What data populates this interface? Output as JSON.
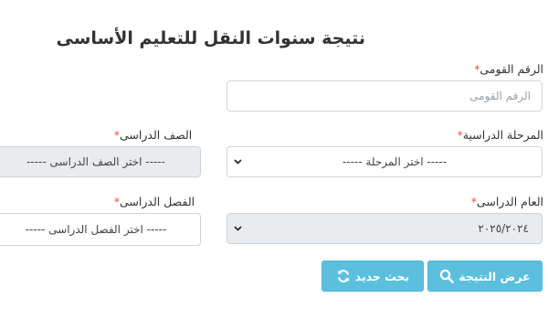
{
  "title": "نتيجة سنوات النقل للتعليم الأساسى",
  "national_id": {
    "label": "الرقم القومى",
    "required_mark": "*",
    "placeholder": "الرقم القومى",
    "value": ""
  },
  "stage": {
    "label": "المرحلة الدراسية",
    "required_mark": "*",
    "selected": "-----  اختر المرحلة  -----"
  },
  "grade": {
    "label": "الصف الدراسى",
    "required_mark": "*",
    "selected": "-----  اختر الصف الدراسى  -----"
  },
  "academic_year": {
    "label": "العام الدراسى",
    "required_mark": "*",
    "selected": "٢٠٢٥/٢٠٢٤"
  },
  "term": {
    "label": "الفصل الدراسى",
    "required_mark": "*",
    "selected": "-----  اختر الفصل الدراسى  -----"
  },
  "buttons": {
    "show_result": "عرض النتيجة",
    "new_search": "بحث جديد"
  },
  "icons": {
    "show_result": "search-icon",
    "new_search": "refresh-icon",
    "select": "chevron-down-icon"
  },
  "colors": {
    "button_bg": "#5bc0de",
    "required": "#e74c3c",
    "disabled_field": "#e9ecef"
  }
}
